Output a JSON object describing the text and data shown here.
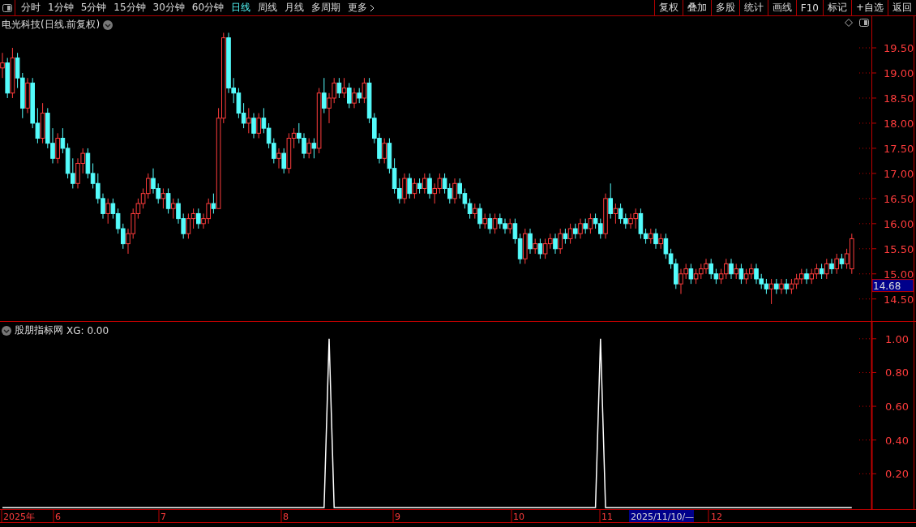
{
  "toolbar": {
    "periods": [
      {
        "label": "分时",
        "selected": false
      },
      {
        "label": "1分钟",
        "selected": false
      },
      {
        "label": "5分钟",
        "selected": false
      },
      {
        "label": "15分钟",
        "selected": false
      },
      {
        "label": "30分钟",
        "selected": false
      },
      {
        "label": "60分钟",
        "selected": false
      },
      {
        "label": "日线",
        "selected": true
      },
      {
        "label": "周线",
        "selected": false
      },
      {
        "label": "月线",
        "selected": false
      },
      {
        "label": "多周期",
        "selected": false
      }
    ],
    "more": "更多",
    "actions": [
      "复权",
      "叠加",
      "多股",
      "统计",
      "画线",
      "F10",
      "标记",
      "+自选",
      "返回"
    ]
  },
  "price_chart": {
    "title": "电光科技(日线.前复权)",
    "current_price": "14.68",
    "chart_data": {
      "type": "candlestick",
      "ylim": [
        14.06,
        20.13
      ],
      "yticks": [
        {
          "value": 19.5,
          "label": "19.50"
        },
        {
          "value": 19,
          "label": "19.00"
        },
        {
          "value": 18.5,
          "label": "18.50"
        },
        {
          "value": 18,
          "label": "18.00"
        },
        {
          "value": 17.5,
          "label": "17.50"
        },
        {
          "value": 17,
          "label": "17.00"
        },
        {
          "value": 16.5,
          "label": "16.50"
        },
        {
          "value": 16,
          "label": "16.00"
        },
        {
          "value": 15.5,
          "label": "15.50"
        },
        {
          "value": 15,
          "label": "15.00"
        },
        {
          "value": 14.5,
          "label": "14.50"
        }
      ],
      "ohlc": [
        [
          19.1,
          19.4,
          18.9,
          19.2
        ],
        [
          19.2,
          19.3,
          18.5,
          18.6
        ],
        [
          18.6,
          19.5,
          18.5,
          19.3
        ],
        [
          19.3,
          19.4,
          18.7,
          18.9
        ],
        [
          18.9,
          19.0,
          18.1,
          18.3
        ],
        [
          18.3,
          18.9,
          18.2,
          18.8
        ],
        [
          18.8,
          18.9,
          17.9,
          18.0
        ],
        [
          18.0,
          18.3,
          17.6,
          17.7
        ],
        [
          17.7,
          18.4,
          17.6,
          18.2
        ],
        [
          18.2,
          18.3,
          17.5,
          17.6
        ],
        [
          17.6,
          17.9,
          17.2,
          17.3
        ],
        [
          17.3,
          17.8,
          17.2,
          17.7
        ],
        [
          17.7,
          17.9,
          17.4,
          17.5
        ],
        [
          17.5,
          17.6,
          16.9,
          17.0
        ],
        [
          17.0,
          17.3,
          16.7,
          16.8
        ],
        [
          16.8,
          17.3,
          16.7,
          17.2
        ],
        [
          17.2,
          17.5,
          17.0,
          17.4
        ],
        [
          17.4,
          17.5,
          16.9,
          17.0
        ],
        [
          17.0,
          17.2,
          16.7,
          16.8
        ],
        [
          16.8,
          17.0,
          16.4,
          16.5
        ],
        [
          16.5,
          16.6,
          16.1,
          16.2
        ],
        [
          16.2,
          16.5,
          16.0,
          16.4
        ],
        [
          16.4,
          16.5,
          16.1,
          16.2
        ],
        [
          16.2,
          16.3,
          15.8,
          15.9
        ],
        [
          15.9,
          16.0,
          15.5,
          15.6
        ],
        [
          15.6,
          15.9,
          15.4,
          15.8
        ],
        [
          15.8,
          16.3,
          15.7,
          16.2
        ],
        [
          16.2,
          16.5,
          16.1,
          16.4
        ],
        [
          16.4,
          16.7,
          16.3,
          16.6
        ],
        [
          16.6,
          17.0,
          16.5,
          16.9
        ],
        [
          16.9,
          17.1,
          16.6,
          16.7
        ],
        [
          16.7,
          16.8,
          16.4,
          16.5
        ],
        [
          16.5,
          16.7,
          16.3,
          16.6
        ],
        [
          16.6,
          16.7,
          16.2,
          16.3
        ],
        [
          16.3,
          16.5,
          16.1,
          16.4
        ],
        [
          16.4,
          16.5,
          16.0,
          16.1
        ],
        [
          16.1,
          16.2,
          15.7,
          15.8
        ],
        [
          15.8,
          16.2,
          15.7,
          16.1
        ],
        [
          16.1,
          16.3,
          15.9,
          16.2
        ],
        [
          16.2,
          16.3,
          15.9,
          16.0
        ],
        [
          16.0,
          16.2,
          15.9,
          16.1
        ],
        [
          16.1,
          16.5,
          16.0,
          16.4
        ],
        [
          16.4,
          16.6,
          16.2,
          16.3
        ],
        [
          16.3,
          18.3,
          16.3,
          18.1
        ],
        [
          18.1,
          19.8,
          18.0,
          19.7
        ],
        [
          19.7,
          19.8,
          18.6,
          18.7
        ],
        [
          18.7,
          18.9,
          18.4,
          18.6
        ],
        [
          18.6,
          18.7,
          18.1,
          18.2
        ],
        [
          18.2,
          18.4,
          17.9,
          18.0
        ],
        [
          18.0,
          18.3,
          17.8,
          18.1
        ],
        [
          18.1,
          18.2,
          17.7,
          17.8
        ],
        [
          17.8,
          18.2,
          17.7,
          18.1
        ],
        [
          18.1,
          18.3,
          17.8,
          17.9
        ],
        [
          17.9,
          18.0,
          17.5,
          17.6
        ],
        [
          17.6,
          17.7,
          17.2,
          17.3
        ],
        [
          17.3,
          17.5,
          17.1,
          17.4
        ],
        [
          17.4,
          17.5,
          17.0,
          17.1
        ],
        [
          17.1,
          17.8,
          17.0,
          17.7
        ],
        [
          17.7,
          17.9,
          17.5,
          17.8
        ],
        [
          17.8,
          18.0,
          17.6,
          17.7
        ],
        [
          17.7,
          17.8,
          17.3,
          17.4
        ],
        [
          17.4,
          17.7,
          17.3,
          17.6
        ],
        [
          17.6,
          17.7,
          17.3,
          17.5
        ],
        [
          17.5,
          18.7,
          17.4,
          18.6
        ],
        [
          18.6,
          18.9,
          18.2,
          18.3
        ],
        [
          18.3,
          18.6,
          18.0,
          18.5
        ],
        [
          18.5,
          18.9,
          18.4,
          18.8
        ],
        [
          18.8,
          18.9,
          18.5,
          18.6
        ],
        [
          18.6,
          18.9,
          18.5,
          18.7
        ],
        [
          18.7,
          18.8,
          18.3,
          18.4
        ],
        [
          18.4,
          18.7,
          18.3,
          18.6
        ],
        [
          18.6,
          18.7,
          18.4,
          18.5
        ],
        [
          18.5,
          18.9,
          18.4,
          18.8
        ],
        [
          18.8,
          18.9,
          18.0,
          18.1
        ],
        [
          18.1,
          18.2,
          17.6,
          17.7
        ],
        [
          17.7,
          17.8,
          17.2,
          17.3
        ],
        [
          17.3,
          17.7,
          17.2,
          17.6
        ],
        [
          17.6,
          17.7,
          17.0,
          17.1
        ],
        [
          17.1,
          17.3,
          16.6,
          16.7
        ],
        [
          16.7,
          16.9,
          16.4,
          16.5
        ],
        [
          16.5,
          17.0,
          16.4,
          16.9
        ],
        [
          16.9,
          17.0,
          16.5,
          16.6
        ],
        [
          16.6,
          16.9,
          16.5,
          16.8
        ],
        [
          16.8,
          16.9,
          16.6,
          16.7
        ],
        [
          16.7,
          17.0,
          16.6,
          16.9
        ],
        [
          16.9,
          17.0,
          16.5,
          16.6
        ],
        [
          16.6,
          16.8,
          16.4,
          16.7
        ],
        [
          16.7,
          17.0,
          16.6,
          16.9
        ],
        [
          16.9,
          17.0,
          16.6,
          16.7
        ],
        [
          16.7,
          16.8,
          16.4,
          16.5
        ],
        [
          16.5,
          16.9,
          16.4,
          16.8
        ],
        [
          16.8,
          16.9,
          16.5,
          16.6
        ],
        [
          16.6,
          16.7,
          16.3,
          16.4
        ],
        [
          16.4,
          16.5,
          16.1,
          16.2
        ],
        [
          16.2,
          16.4,
          16.1,
          16.3
        ],
        [
          16.3,
          16.4,
          15.9,
          16.0
        ],
        [
          16.0,
          16.2,
          15.9,
          16.1
        ],
        [
          16.1,
          16.2,
          15.8,
          15.9
        ],
        [
          15.9,
          16.2,
          15.8,
          16.1
        ],
        [
          16.1,
          16.2,
          15.9,
          16.0
        ],
        [
          16.0,
          16.1,
          15.8,
          15.9
        ],
        [
          15.9,
          16.1,
          15.8,
          16.0
        ],
        [
          16.0,
          16.1,
          15.6,
          15.7
        ],
        [
          15.7,
          15.8,
          15.2,
          15.3
        ],
        [
          15.3,
          15.9,
          15.2,
          15.8
        ],
        [
          15.8,
          15.9,
          15.4,
          15.5
        ],
        [
          15.5,
          15.7,
          15.4,
          15.6
        ],
        [
          15.6,
          15.7,
          15.3,
          15.4
        ],
        [
          15.4,
          15.7,
          15.3,
          15.6
        ],
        [
          15.6,
          15.8,
          15.5,
          15.7
        ],
        [
          15.7,
          15.8,
          15.4,
          15.5
        ],
        [
          15.5,
          15.9,
          15.4,
          15.8
        ],
        [
          15.8,
          15.9,
          15.6,
          15.7
        ],
        [
          15.7,
          16.0,
          15.6,
          15.9
        ],
        [
          15.9,
          16.0,
          15.7,
          15.8
        ],
        [
          15.8,
          16.1,
          15.7,
          16.0
        ],
        [
          16.0,
          16.1,
          15.8,
          15.9
        ],
        [
          15.9,
          16.2,
          15.8,
          16.1
        ],
        [
          16.1,
          16.2,
          15.9,
          16.0
        ],
        [
          16.0,
          16.1,
          15.7,
          15.8
        ],
        [
          15.8,
          16.6,
          15.7,
          16.5
        ],
        [
          16.5,
          16.8,
          16.1,
          16.2
        ],
        [
          16.2,
          16.4,
          16.0,
          16.3
        ],
        [
          16.3,
          16.4,
          16.0,
          16.1
        ],
        [
          16.1,
          16.2,
          15.9,
          16.0
        ],
        [
          16.0,
          16.2,
          15.9,
          16.1
        ],
        [
          16.1,
          16.3,
          15.9,
          16.2
        ],
        [
          16.2,
          16.3,
          15.7,
          15.8
        ],
        [
          15.8,
          15.9,
          15.6,
          15.7
        ],
        [
          15.7,
          15.9,
          15.6,
          15.8
        ],
        [
          15.8,
          15.9,
          15.5,
          15.6
        ],
        [
          15.6,
          15.8,
          15.5,
          15.7
        ],
        [
          15.7,
          15.8,
          15.3,
          15.4
        ],
        [
          15.4,
          15.5,
          15.1,
          15.2
        ],
        [
          15.2,
          15.3,
          14.7,
          14.8
        ],
        [
          14.8,
          15.1,
          14.6,
          15.0
        ],
        [
          15.0,
          15.2,
          14.9,
          15.1
        ],
        [
          15.1,
          15.2,
          14.8,
          14.9
        ],
        [
          14.9,
          15.1,
          14.8,
          15.0
        ],
        [
          15.0,
          15.2,
          14.9,
          15.1
        ],
        [
          15.1,
          15.3,
          15.0,
          15.2
        ],
        [
          15.2,
          15.3,
          14.9,
          15.0
        ],
        [
          15.0,
          15.1,
          14.8,
          14.9
        ],
        [
          14.9,
          15.1,
          14.8,
          15.0
        ],
        [
          15.0,
          15.3,
          14.9,
          15.2
        ],
        [
          15.2,
          15.3,
          14.9,
          15.0
        ],
        [
          15.0,
          15.2,
          14.9,
          15.1
        ],
        [
          15.1,
          15.2,
          14.8,
          14.9
        ],
        [
          14.9,
          15.1,
          14.8,
          15.0
        ],
        [
          15.0,
          15.2,
          14.9,
          15.1
        ],
        [
          15.1,
          15.2,
          14.8,
          14.9
        ],
        [
          14.9,
          15.0,
          14.7,
          14.8
        ],
        [
          14.8,
          14.9,
          14.6,
          14.7
        ],
        [
          14.7,
          14.9,
          14.4,
          14.8
        ],
        [
          14.8,
          14.9,
          14.6,
          14.7
        ],
        [
          14.7,
          14.9,
          14.6,
          14.8
        ],
        [
          14.8,
          14.9,
          14.6,
          14.7
        ],
        [
          14.7,
          14.9,
          14.6,
          14.8
        ],
        [
          14.8,
          15.0,
          14.7,
          14.9
        ],
        [
          14.9,
          15.1,
          14.8,
          15.0
        ],
        [
          15.0,
          15.1,
          14.8,
          14.9
        ],
        [
          14.9,
          15.1,
          14.8,
          15.0
        ],
        [
          15.0,
          15.2,
          14.9,
          15.1
        ],
        [
          15.1,
          15.2,
          14.9,
          15.0
        ],
        [
          15.0,
          15.3,
          14.9,
          15.2
        ],
        [
          15.2,
          15.3,
          15.0,
          15.1
        ],
        [
          15.1,
          15.4,
          15.0,
          15.3
        ],
        [
          15.3,
          15.4,
          15.1,
          15.2
        ],
        [
          15.2,
          15.5,
          15.1,
          15.4
        ],
        [
          15.1,
          15.8,
          15.0,
          15.7
        ]
      ]
    }
  },
  "indicator": {
    "title": "股朋指标网",
    "separator": ":",
    "reading": "0.00",
    "chart_data": {
      "type": "line",
      "ylim": [
        0,
        1.1
      ],
      "yticks": [
        {
          "value": 1,
          "label": "1.00"
        },
        {
          "value": 0.8,
          "label": "0.80"
        },
        {
          "value": 0.6,
          "label": "0.60"
        },
        {
          "value": 0.4,
          "label": "0.40"
        },
        {
          "value": 0.2,
          "label": "0.20"
        }
      ],
      "series": [
        {
          "name": "XG",
          "color": "#ffffff",
          "values": [
            0,
            0,
            0,
            0,
            0,
            0,
            0,
            0,
            0,
            0,
            0,
            0,
            0,
            0,
            0,
            0,
            0,
            0,
            0,
            0,
            0,
            0,
            0,
            0,
            0,
            0,
            0,
            0,
            0,
            0,
            0,
            0,
            0,
            0,
            0,
            0,
            0,
            0,
            0,
            0,
            0,
            0,
            0,
            0,
            0,
            0,
            0,
            0,
            0,
            0,
            0,
            0,
            0,
            0,
            0,
            0,
            0,
            0,
            0,
            0,
            0,
            0,
            0,
            0,
            0,
            1,
            0,
            0,
            0,
            0,
            0,
            0,
            0,
            0,
            0,
            0,
            0,
            0,
            0,
            0,
            0,
            0,
            0,
            0,
            0,
            0,
            0,
            0,
            0,
            0,
            0,
            0,
            0,
            0,
            0,
            0,
            0,
            0,
            0,
            0,
            0,
            0,
            0,
            0,
            0,
            0,
            0,
            0,
            0,
            0,
            0,
            0,
            0,
            0,
            0,
            0,
            0,
            0,
            0,
            1,
            0,
            0,
            0,
            0,
            0,
            0,
            0,
            0,
            0,
            0,
            0,
            0,
            0,
            0,
            0,
            0,
            0,
            0,
            0,
            0,
            0,
            0,
            0,
            0,
            0,
            0,
            0,
            0,
            0,
            0,
            0,
            0,
            0,
            0,
            0,
            0,
            0,
            0,
            0,
            0,
            0,
            0,
            0,
            0,
            0,
            0,
            0,
            0,
            0,
            0
          ]
        }
      ]
    }
  },
  "date_axis": {
    "labels": [
      "2025年",
      "6",
      "7",
      "8",
      "9",
      "10",
      "11"
    ],
    "cursor_date": "2025/11/10/—",
    "after_cursor": "12"
  }
}
